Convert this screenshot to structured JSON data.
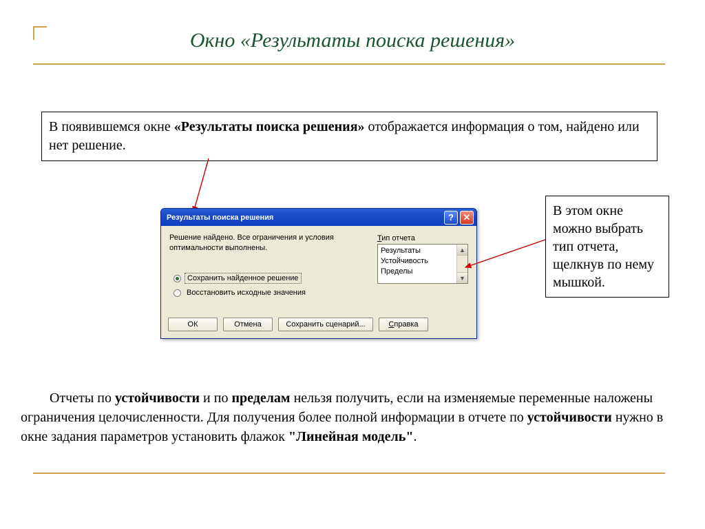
{
  "title": "Окно «Результаты  поиска решения»",
  "intro": {
    "pre": "В появившемся окне ",
    "bold": "«Результаты поиска решения»",
    "post": " отображается информация о том, найдено или нет решение."
  },
  "side_note": "В этом окне можно выбрать тип отчета, щелкнув по нему мышкой.",
  "dialog": {
    "title": "Результаты поиска решения",
    "help_glyph": "?",
    "close_glyph": "✕",
    "status": "Решение найдено. Все ограничения и условия оптимальности выполнены.",
    "radios": {
      "keep": "Сохранить найденное решение",
      "restore": "Восстановить исходные значения"
    },
    "group_label_u": "Т",
    "group_label_rest": "ип отчета",
    "reports": [
      "Результаты",
      "Устойчивость",
      "Пределы"
    ],
    "buttons": {
      "ok": "ОК",
      "cancel": "Отмена",
      "save": "Сохранить сценарий...",
      "help_u": "С",
      "help_rest": "правка"
    },
    "scroll_up": "▲",
    "scroll_down": "▼"
  },
  "para": {
    "t1": "Отчеты по ",
    "b1": "устойчивости",
    "t2": " и по ",
    "b2": "пределам",
    "t3": " нельзя получить, если на изменяемые переменные наложены ограничения целочисленности. Для получения более полной информации в отчете по ",
    "b3": "устойчивости",
    "t4": " нужно в окне задания параметров установить флажок ",
    "b4": "\"Линейная модель\"",
    "t5": "."
  }
}
